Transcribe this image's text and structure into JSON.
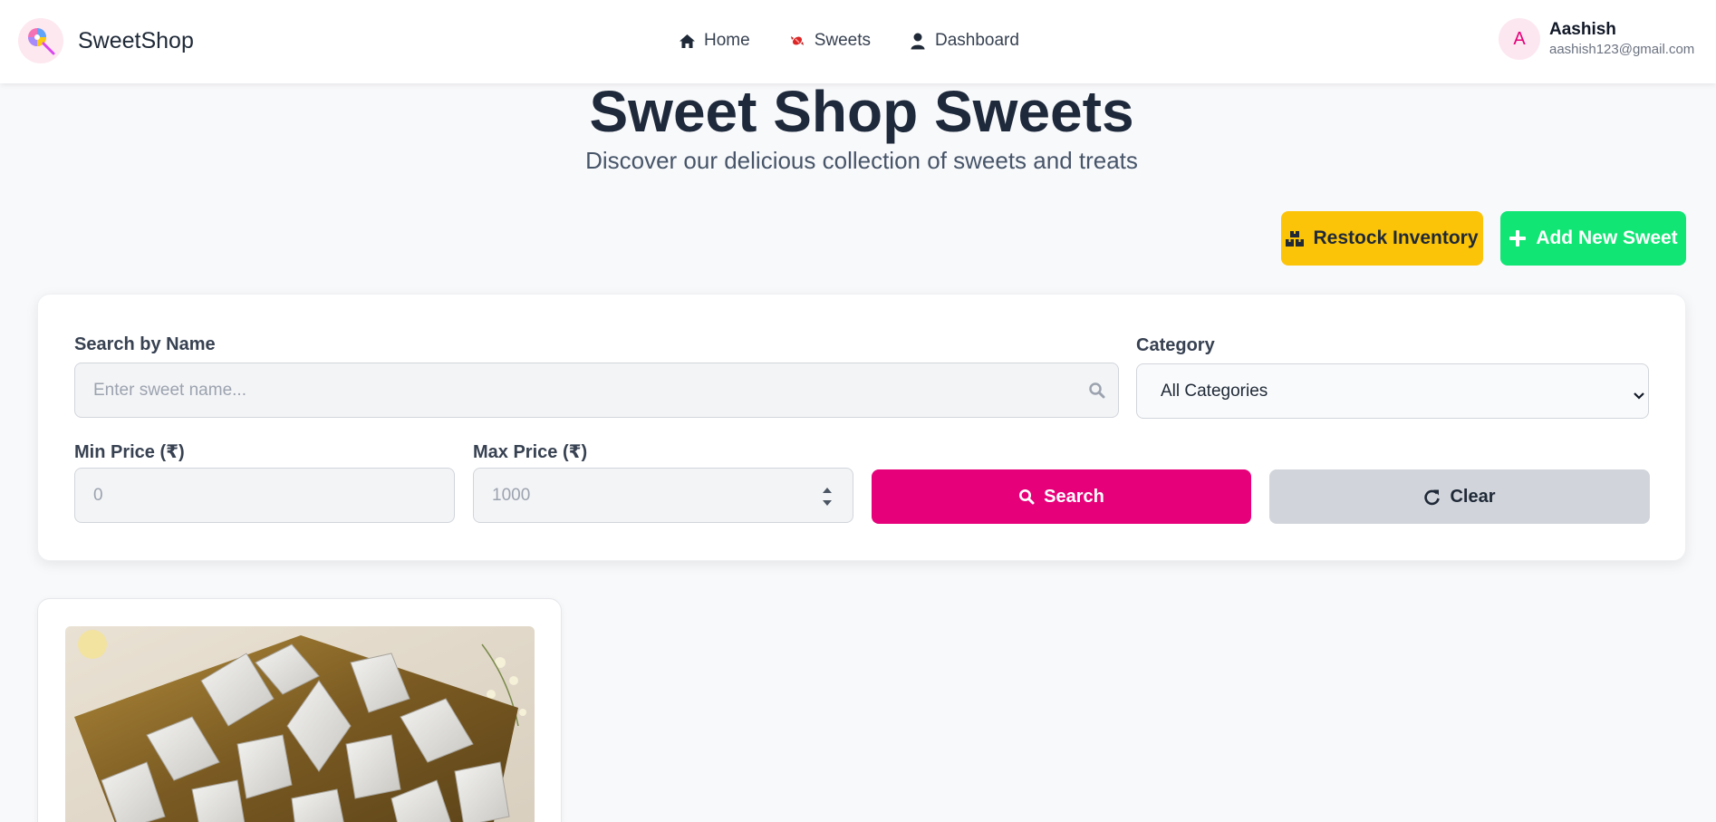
{
  "nav": {
    "brand": "SweetShop",
    "links": [
      {
        "label": "Home",
        "icon": "home-icon"
      },
      {
        "label": "Sweets",
        "icon": "candy-icon"
      },
      {
        "label": "Dashboard",
        "icon": "user-icon"
      }
    ],
    "user": {
      "initial": "A",
      "name": "Aashish",
      "email": "aashish123@gmail.com"
    }
  },
  "header": {
    "title": "Sweet Shop Sweets",
    "subtitle": "Discover our delicious collection of sweets and treats"
  },
  "actions": {
    "restock_label": "Restock Inventory",
    "add_label": "Add New Sweet"
  },
  "filters": {
    "search_label": "Search by Name",
    "search_placeholder": "Enter sweet name...",
    "category_label": "Category",
    "category_selected": "All Categories",
    "min_price_label": "Min Price (₹)",
    "min_price_placeholder": "0",
    "max_price_label": "Max Price (₹)",
    "max_price_placeholder": "1000",
    "search_button": "Search",
    "clear_button": "Clear"
  },
  "colors": {
    "brand_pink": "#e6007a",
    "restock_yellow": "#fcc409",
    "add_green": "#11e574",
    "clear_gray": "#d1d5db",
    "title_dark": "#1e293b"
  }
}
